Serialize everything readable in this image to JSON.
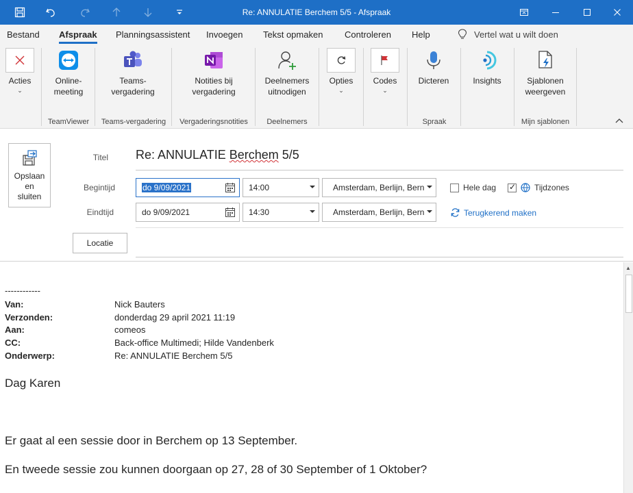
{
  "window": {
    "title": "Re: ANNULATIE Berchem 5/5  -  Afspraak"
  },
  "tabs": [
    "Bestand",
    "Afspraak",
    "Planningsassistent",
    "Invoegen",
    "Tekst opmaken",
    "Controleren",
    "Help"
  ],
  "tell_me": "Vertel wat u wilt doen",
  "ribbon": {
    "acties": "Acties",
    "online_meeting": [
      "Online-",
      "meeting"
    ],
    "teams_meeting": [
      "Teams-",
      "vergadering"
    ],
    "notities": [
      "Notities bij",
      "vergadering"
    ],
    "deelnemers": [
      "Deelnemers",
      "uitnodigen"
    ],
    "opties": "Opties",
    "codes": "Codes",
    "dicteren": "Dicteren",
    "insights": "Insights",
    "sjablonen": [
      "Sjablonen",
      "weergeven"
    ],
    "groups": {
      "teamviewer": "TeamViewer",
      "teams": "Teams-vergadering",
      "notities": "Vergaderingsnotities",
      "deelnemers": "Deelnemers",
      "spraak": "Spraak",
      "sjablonen": "Mijn sjablonen"
    }
  },
  "form": {
    "save": [
      "Opslaan",
      "en",
      "sluiten"
    ],
    "title_label": "Titel",
    "title_prefix": "Re: ANNULATIE ",
    "title_misspelled": "Berchem",
    "title_suffix": " 5/5",
    "start_label": "Begintijd",
    "end_label": "Eindtijd",
    "start_date": "do 9/09/2021",
    "start_time": "14:00",
    "end_date": "do 9/09/2021",
    "end_time": "14:30",
    "timezone": "Amsterdam, Berlijn, Bern",
    "all_day": "Hele dag",
    "all_day_checked": false,
    "timezones": "Tijdzones",
    "timezones_checked": true,
    "recurring": "Terugkerend maken",
    "location_button": "Locatie",
    "location_value": ""
  },
  "message": {
    "separator": "------------",
    "headers": [
      {
        "key": "Van:",
        "value": "Nick Bauters"
      },
      {
        "key": "Verzonden:",
        "value": "donderdag 29 april 2021 11:19"
      },
      {
        "key": "Aan:",
        "value": "comeos"
      },
      {
        "key": "CC:",
        "value": "Back-office Multimedi; Hilde Vandenberk"
      },
      {
        "key": "Onderwerp:",
        "value": "Re: ANNULATIE Berchem 5/5"
      }
    ],
    "greeting": "Dag Karen",
    "line1": "Er gaat al een sessie door in Berchem op 13 September.",
    "line2": "En tweede sessie zou kunnen doorgaan op 27, 28 of 30 September of 1 Oktober?"
  },
  "colors": {
    "accent": "#1e6fc6",
    "ribbon_bg": "#f3f3f3",
    "selection": "#2a72c9"
  }
}
